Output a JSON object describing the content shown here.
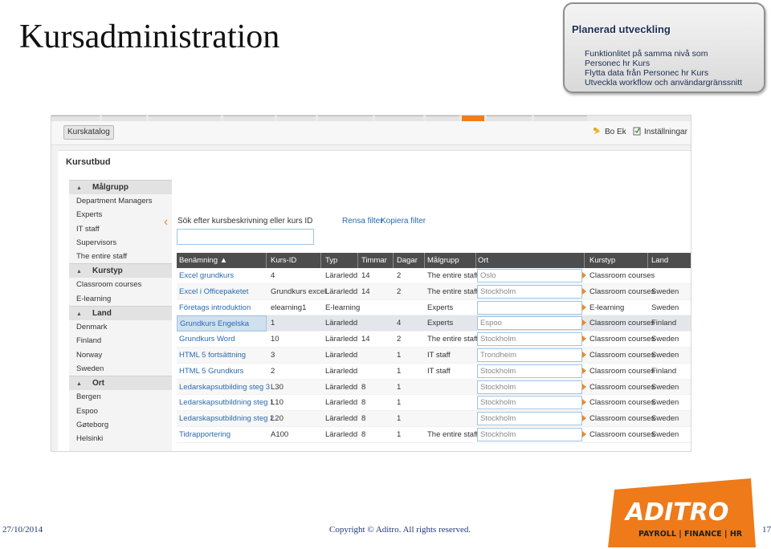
{
  "slide": {
    "title": "Kursadministration",
    "plan_title": "Planerad utveckling",
    "plan_items": [
      "Funktionlitet på samma nivå som",
      "Personec hr Kurs",
      "Flytta data från Personec hr Kurs",
      "Utveckla workflow och användargränssnitt"
    ],
    "footer_date": "27/10/2014",
    "footer_copyright": "Copyright © Aditro. All rights reserved.",
    "page_number": "17",
    "logo_main": "ADITRO",
    "logo_sub": "PAYROLL | FINANCE | HR"
  },
  "app": {
    "tab_label": "Kurskatalog",
    "user_label": "Bo Ek",
    "settings_label": "Inställningar",
    "page_heading": "Kursutbud",
    "search_label": "Sök efter kursbeskrivning eller kurs ID",
    "search_value": "",
    "clear_filter": "Rensa filter",
    "copy_filter": "Kopiera filter",
    "filters": [
      {
        "title": "Målgrupp",
        "items": [
          "Department Managers",
          "Experts",
          "IT staff",
          "Supervisors",
          "The entire staff"
        ]
      },
      {
        "title": "Kurstyp",
        "items": [
          "Classroom courses",
          "E-learning"
        ]
      },
      {
        "title": "Land",
        "items": [
          "Denmark",
          "Finland",
          "Norway",
          "Sweden"
        ]
      },
      {
        "title": "Ort",
        "items": [
          "Bergen",
          "Espoo",
          "Gøteborg",
          "Helsinki"
        ]
      }
    ],
    "columns": [
      "Benämning ▲",
      "Kurs-ID",
      "Typ",
      "Timmar",
      "Dagar",
      "Målgrupp",
      "Ort",
      "Kurstyp",
      "Land"
    ],
    "rows": [
      {
        "name": "Excel grundkurs",
        "id": "4",
        "typ": "Lärarledd",
        "timmar": "14",
        "dagar": "2",
        "malgrupp": "The entire staff",
        "ort": "Oslo",
        "kurstyp": "Classroom courses",
        "land": ""
      },
      {
        "name": "Excel i Officepaketet",
        "id": "Grundkurs excel",
        "typ": "Lärarledd",
        "timmar": "14",
        "dagar": "2",
        "malgrupp": "The entire staff",
        "ort": "Stockholm",
        "kurstyp": "Classroom courses",
        "land": "Sweden"
      },
      {
        "name": "Företags introduktion",
        "id": "elearning1",
        "typ": "E-learning",
        "timmar": "",
        "dagar": "",
        "malgrupp": "Experts",
        "ort": "",
        "kurstyp": "E-learning",
        "land": "Sweden"
      },
      {
        "name": "Grundkurs Engelska",
        "id": "1",
        "typ": "Lärarledd",
        "timmar": "",
        "dagar": "4",
        "malgrupp": "Experts",
        "ort": "Espoo",
        "kurstyp": "Classroom courses",
        "land": "Finland"
      },
      {
        "name": "Grundkurs Word",
        "id": "10",
        "typ": "Lärarledd",
        "timmar": "14",
        "dagar": "2",
        "malgrupp": "The entire staff",
        "ort": "Stockholm",
        "kurstyp": "Classroom courses",
        "land": "Sweden"
      },
      {
        "name": "HTML 5 fortsättning",
        "id": "3",
        "typ": "Lärarledd",
        "timmar": "",
        "dagar": "1",
        "malgrupp": "IT staff",
        "ort": "Trondheim",
        "kurstyp": "Classroom courses",
        "land": "Sweden"
      },
      {
        "name": "HTML 5 Grundkurs",
        "id": "2",
        "typ": "Lärarledd",
        "timmar": "",
        "dagar": "1",
        "malgrupp": "IT staff",
        "ort": "Stockholm",
        "kurstyp": "Classroom courses",
        "land": "Finland"
      },
      {
        "name": "Ledarskapsutbilding steg 3",
        "id": "L30",
        "typ": "Lärarledd",
        "timmar": "8",
        "dagar": "1",
        "malgrupp": "",
        "ort": "Stockholm",
        "kurstyp": "Classroom courses",
        "land": "Sweden"
      },
      {
        "name": "Ledarskapsutbildning steg 1",
        "id": "L10",
        "typ": "Lärarledd",
        "timmar": "8",
        "dagar": "1",
        "malgrupp": "",
        "ort": "Stockholm",
        "kurstyp": "Classroom courses",
        "land": "Sweden"
      },
      {
        "name": "Ledarskapsutbildning steg 2",
        "id": "L20",
        "typ": "Lärarledd",
        "timmar": "8",
        "dagar": "1",
        "malgrupp": "",
        "ort": "Stockholm",
        "kurstyp": "Classroom courses",
        "land": "Sweden"
      },
      {
        "name": "Tidrapportering",
        "id": "A100",
        "typ": "Lärarledd",
        "timmar": "8",
        "dagar": "1",
        "malgrupp": "The entire staff",
        "ort": "Stockholm",
        "kurstyp": "Classroom courses",
        "land": "Sweden"
      }
    ],
    "highlighted_row": 3
  },
  "colors": {
    "accent": "#f08a1e",
    "link": "#2b6bb0",
    "grid_header": "#4d4d4d",
    "footer_text": "#1f3a78",
    "logo": "#ee7a1a"
  }
}
